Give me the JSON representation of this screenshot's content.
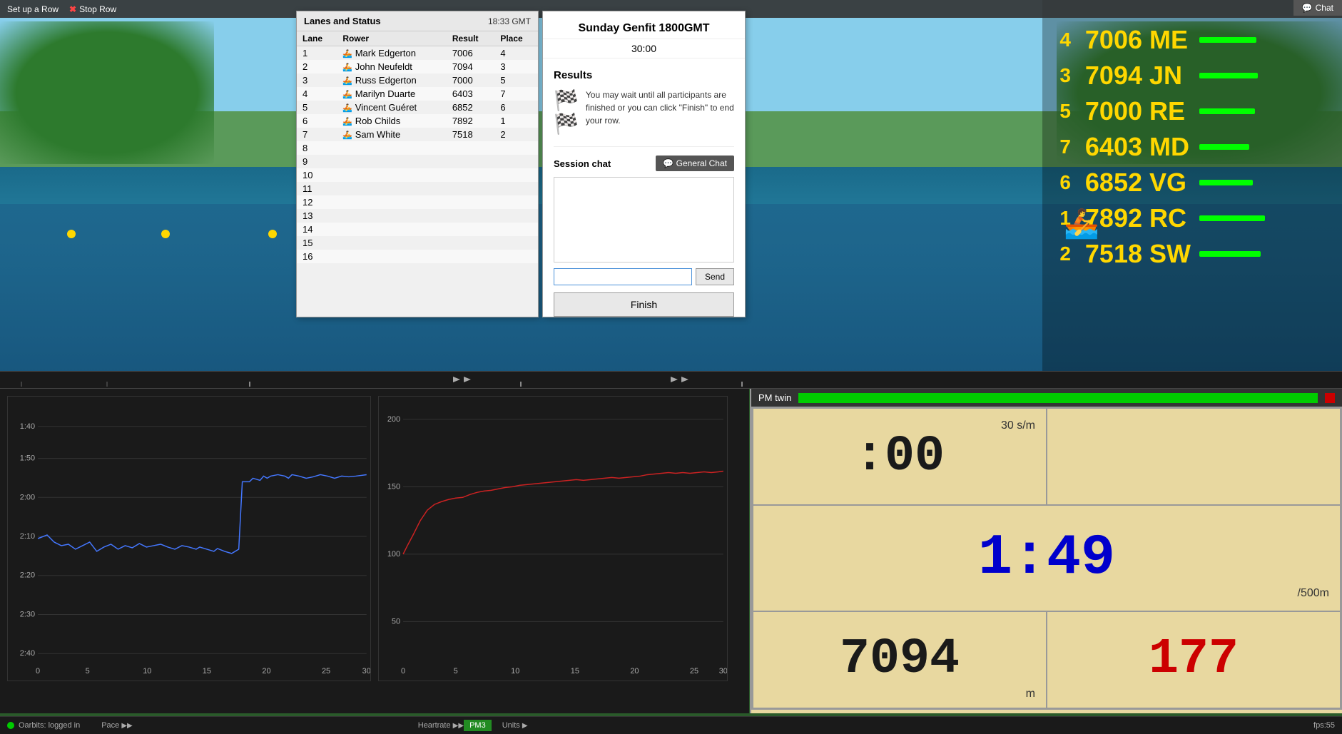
{
  "topbar": {
    "setup_row": "Set up a Row",
    "stop_row": "Stop Row",
    "chat_tab": "Chat"
  },
  "lanes_panel": {
    "title": "Lanes and Status",
    "time": "18:33 GMT",
    "columns": [
      "Lane",
      "Rower",
      "Result",
      "Place"
    ],
    "rows": [
      {
        "lane": "1",
        "rower": "Mark Edgerton",
        "result": "7006",
        "place": "4",
        "has_icon": true
      },
      {
        "lane": "2",
        "rower": "John Neufeldt",
        "result": "7094",
        "place": "3",
        "has_icon": true
      },
      {
        "lane": "3",
        "rower": "Russ Edgerton",
        "result": "7000",
        "place": "5",
        "has_icon": true
      },
      {
        "lane": "4",
        "rower": "Marilyn Duarte",
        "result": "6403",
        "place": "7",
        "has_icon": true
      },
      {
        "lane": "5",
        "rower": "Vincent Guéret",
        "result": "6852",
        "place": "6",
        "has_icon": true
      },
      {
        "lane": "6",
        "rower": "Rob Childs",
        "result": "7892",
        "place": "1",
        "has_icon": true
      },
      {
        "lane": "7",
        "rower": "Sam White",
        "result": "7518",
        "place": "2",
        "has_icon": true
      },
      {
        "lane": "8",
        "rower": "",
        "result": "",
        "place": ""
      },
      {
        "lane": "9",
        "rower": "",
        "result": "",
        "place": ""
      },
      {
        "lane": "10",
        "rower": "",
        "result": "",
        "place": ""
      },
      {
        "lane": "11",
        "rower": "",
        "result": "",
        "place": ""
      },
      {
        "lane": "12",
        "rower": "",
        "result": "",
        "place": ""
      },
      {
        "lane": "13",
        "rower": "",
        "result": "",
        "place": ""
      },
      {
        "lane": "14",
        "rower": "",
        "result": "",
        "place": ""
      },
      {
        "lane": "15",
        "rower": "",
        "result": "",
        "place": ""
      },
      {
        "lane": "16",
        "rower": "",
        "result": "",
        "place": ""
      }
    ]
  },
  "results": {
    "title": "Sunday Genfit 1800GMT",
    "time": "30:00",
    "heading": "Results",
    "description": "You may wait until all participants are finished or you can click \"Finish\" to end your row.",
    "finish_btn": "Finish"
  },
  "chat": {
    "session_label": "Session chat",
    "general_chat_btn": "💬 General Chat",
    "send_btn": "Send",
    "input_placeholder": ""
  },
  "leaderboard": {
    "rows": [
      {
        "place": "4",
        "score": "7006",
        "initials": "ME"
      },
      {
        "place": "3",
        "score": "7094",
        "initials": "JN"
      },
      {
        "place": "5",
        "score": "7000",
        "initials": "RE"
      },
      {
        "place": "7",
        "score": "6403",
        "initials": "MD"
      },
      {
        "place": "6",
        "score": "6852",
        "initials": "VG"
      },
      {
        "place": "1",
        "score": "7892",
        "initials": "RC"
      },
      {
        "place": "2",
        "score": "7518",
        "initials": "SW"
      }
    ]
  },
  "pm_panel": {
    "title": "PM twin",
    "time_value": ":00",
    "spm_value": "30",
    "spm_label": "s/m",
    "pace_value": "1:49",
    "per500_label": "/500m",
    "meters_value": "7094",
    "m_label": "m",
    "watts_value": "177"
  },
  "bottom_charts": {
    "left_title": "Pace",
    "right_title": "Heartrate",
    "left_y_labels": [
      "1:40",
      "1:50",
      "2:00",
      "2:10",
      "2:20",
      "2:30",
      "2:40"
    ],
    "right_y_labels": [
      "200",
      "150",
      "100",
      "50"
    ],
    "x_labels": [
      "0",
      "5",
      "10",
      "15",
      "20",
      "25",
      "30"
    ]
  },
  "status_bar": {
    "orbits": "Oarbits: logged in",
    "pace_label": "Pace",
    "heartrate_label": "Heartrate",
    "pm3_label": "PM3",
    "units_label": "Units",
    "fps_label": "fps:55"
  }
}
